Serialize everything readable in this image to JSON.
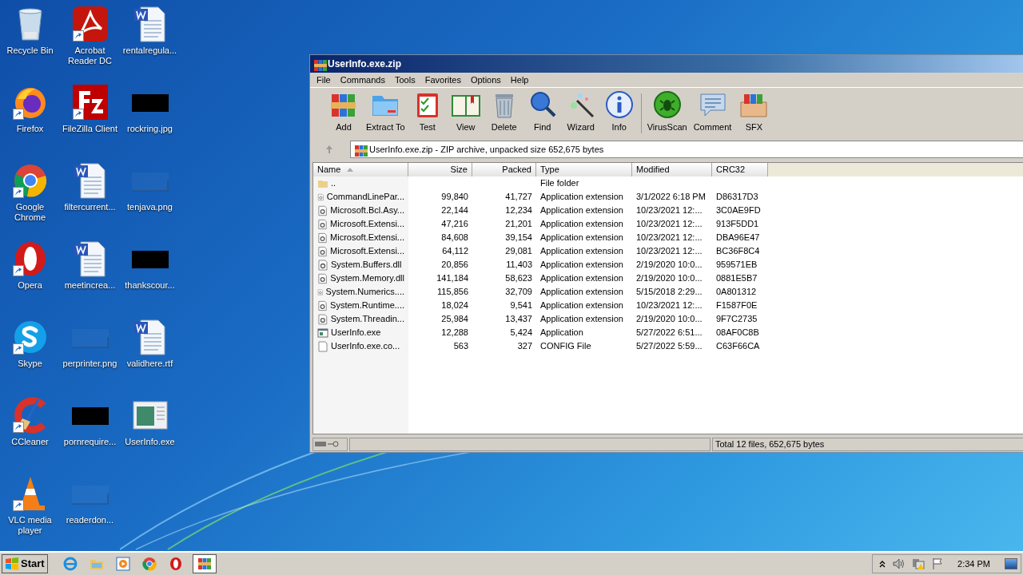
{
  "desktop": {
    "icons": [
      {
        "label": "Recycle Bin",
        "kind": "recycle-bin",
        "shortcut": false
      },
      {
        "label": "Firefox",
        "kind": "firefox",
        "shortcut": true
      },
      {
        "label": "Google Chrome",
        "kind": "chrome",
        "shortcut": true
      },
      {
        "label": "Opera",
        "kind": "opera",
        "shortcut": true
      },
      {
        "label": "Skype",
        "kind": "skype",
        "shortcut": true
      },
      {
        "label": "CCleaner",
        "kind": "ccleaner",
        "shortcut": true
      },
      {
        "label": "VLC media player",
        "kind": "vlc",
        "shortcut": true
      },
      {
        "label": "Acrobat Reader DC",
        "kind": "acrobat",
        "shortcut": true
      },
      {
        "label": "FileZilla Client",
        "kind": "filezilla",
        "shortcut": true
      },
      {
        "label": "filtercurrent...",
        "kind": "word",
        "shortcut": false
      },
      {
        "label": "meetincrea...",
        "kind": "word",
        "shortcut": false
      },
      {
        "label": "perprinter.png",
        "kind": "blank-image",
        "shortcut": false
      },
      {
        "label": "pornrequire...",
        "kind": "dark-image",
        "shortcut": false
      },
      {
        "label": "readerdon...",
        "kind": "blank-image",
        "shortcut": false
      },
      {
        "label": "rentalregula...",
        "kind": "word",
        "shortcut": false
      },
      {
        "label": "rockring.jpg",
        "kind": "dark-image",
        "shortcut": false
      },
      {
        "label": "tenjava.png",
        "kind": "blank-image",
        "shortcut": false
      },
      {
        "label": "thankscour...",
        "kind": "dark-image",
        "shortcut": false
      },
      {
        "label": "validhere.rtf",
        "kind": "word",
        "shortcut": false
      },
      {
        "label": "UserInfo.exe",
        "kind": "exe",
        "shortcut": false
      }
    ]
  },
  "window": {
    "title": "UserInfo.exe.zip",
    "menu": [
      "File",
      "Commands",
      "Tools",
      "Favorites",
      "Options",
      "Help"
    ],
    "toolbar": [
      {
        "label": "Add",
        "kind": "add"
      },
      {
        "label": "Extract To",
        "kind": "extract"
      },
      {
        "label": "Test",
        "kind": "test"
      },
      {
        "label": "View",
        "kind": "view"
      },
      {
        "label": "Delete",
        "kind": "delete"
      },
      {
        "label": "Find",
        "kind": "find"
      },
      {
        "label": "Wizard",
        "kind": "wizard"
      },
      {
        "label": "Info",
        "kind": "info"
      },
      {
        "label": "VirusScan",
        "kind": "virusscan"
      },
      {
        "label": "Comment",
        "kind": "comment"
      },
      {
        "label": "SFX",
        "kind": "sfx"
      }
    ],
    "address": "UserInfo.exe.zip - ZIP archive, unpacked size 652,675 bytes",
    "columns": [
      {
        "label": "Name",
        "sorted": true
      },
      {
        "label": "Size",
        "sorted": false
      },
      {
        "label": "Packed",
        "sorted": false
      },
      {
        "label": "Type",
        "sorted": false
      },
      {
        "label": "Modified",
        "sorted": false
      },
      {
        "label": "CRC32",
        "sorted": false
      }
    ],
    "rows": [
      {
        "kind": "folder",
        "name": "..",
        "size": "",
        "packed": "",
        "type": "File folder",
        "modified": "",
        "crc32": ""
      },
      {
        "kind": "dll",
        "name": "CommandLinePar...",
        "size": "99,840",
        "packed": "41,727",
        "type": "Application extension",
        "modified": "3/1/2022 6:18 PM",
        "crc32": "D86317D3"
      },
      {
        "kind": "dll",
        "name": "Microsoft.Bcl.Asy...",
        "size": "22,144",
        "packed": "12,234",
        "type": "Application extension",
        "modified": "10/23/2021 12:...",
        "crc32": "3C0AE9FD"
      },
      {
        "kind": "dll",
        "name": "Microsoft.Extensi...",
        "size": "47,216",
        "packed": "21,201",
        "type": "Application extension",
        "modified": "10/23/2021 12:...",
        "crc32": "913F5DD1"
      },
      {
        "kind": "dll",
        "name": "Microsoft.Extensi...",
        "size": "84,608",
        "packed": "39,154",
        "type": "Application extension",
        "modified": "10/23/2021 12:...",
        "crc32": "DBA96E47"
      },
      {
        "kind": "dll",
        "name": "Microsoft.Extensi...",
        "size": "64,112",
        "packed": "29,081",
        "type": "Application extension",
        "modified": "10/23/2021 12:...",
        "crc32": "BC36F8C4"
      },
      {
        "kind": "dll",
        "name": "System.Buffers.dll",
        "size": "20,856",
        "packed": "11,403",
        "type": "Application extension",
        "modified": "2/19/2020 10:0...",
        "crc32": "959571EB"
      },
      {
        "kind": "dll",
        "name": "System.Memory.dll",
        "size": "141,184",
        "packed": "58,623",
        "type": "Application extension",
        "modified": "2/19/2020 10:0...",
        "crc32": "0881E5B7"
      },
      {
        "kind": "dll",
        "name": "System.Numerics....",
        "size": "115,856",
        "packed": "32,709",
        "type": "Application extension",
        "modified": "5/15/2018 2:29...",
        "crc32": "0A801312"
      },
      {
        "kind": "dll",
        "name": "System.Runtime....",
        "size": "18,024",
        "packed": "9,541",
        "type": "Application extension",
        "modified": "10/23/2021 12:...",
        "crc32": "F1587F0E"
      },
      {
        "kind": "dll",
        "name": "System.Threadin...",
        "size": "25,984",
        "packed": "13,437",
        "type": "Application extension",
        "modified": "2/19/2020 10:0...",
        "crc32": "9F7C2735"
      },
      {
        "kind": "exe",
        "name": "UserInfo.exe",
        "size": "12,288",
        "packed": "5,424",
        "type": "Application",
        "modified": "5/27/2022 6:51...",
        "crc32": "08AF0C8B"
      },
      {
        "kind": "config",
        "name": "UserInfo.exe.co...",
        "size": "563",
        "packed": "327",
        "type": "CONFIG File",
        "modified": "5/27/2022 5:59...",
        "crc32": "C63F66CA"
      }
    ],
    "status": "Total 12 files, 652,675 bytes"
  },
  "taskbar": {
    "start": "Start",
    "items": [
      {
        "kind": "ie",
        "selected": false
      },
      {
        "kind": "explorer",
        "selected": false
      },
      {
        "kind": "media",
        "selected": false
      },
      {
        "kind": "chrome",
        "selected": false
      },
      {
        "kind": "opera",
        "selected": false
      },
      {
        "kind": "winrar",
        "selected": true
      }
    ],
    "time": "2:34 PM"
  }
}
